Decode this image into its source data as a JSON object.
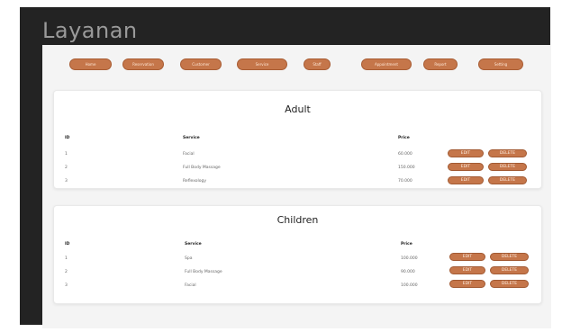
{
  "app": {
    "title": "Layanan"
  },
  "nav": {
    "tabs": [
      {
        "label": "Home"
      },
      {
        "label": "Reservation"
      },
      {
        "label": "Customer"
      },
      {
        "label": "Service"
      },
      {
        "label": "Staff"
      },
      {
        "label": "Appointment"
      },
      {
        "label": "Report"
      },
      {
        "label": "Setting"
      }
    ]
  },
  "sections": {
    "adult": {
      "title": "Adult",
      "headers": {
        "id": "ID",
        "service": "Service",
        "price": "Price"
      },
      "rows": [
        {
          "id": "1",
          "service": "Facial",
          "price": "60.000"
        },
        {
          "id": "2",
          "service": "Full Body Massage",
          "price": "150.000"
        },
        {
          "id": "3",
          "service": "Reflexology",
          "price": "70.000"
        }
      ]
    },
    "children": {
      "title": "Children",
      "headers": {
        "id": "ID",
        "service": "Service",
        "price": "Price"
      },
      "rows": [
        {
          "id": "1",
          "service": "Spa",
          "price": "100.000"
        },
        {
          "id": "2",
          "service": "Full Body Massage",
          "price": "90.000"
        },
        {
          "id": "3",
          "service": "Facial",
          "price": "100.000"
        }
      ]
    }
  },
  "actions": {
    "edit_label": "EDIT",
    "delete_label": "DELETE"
  },
  "colors": {
    "accent": "#c5764a",
    "background": "#232323",
    "panel": "#f4f4f4"
  }
}
